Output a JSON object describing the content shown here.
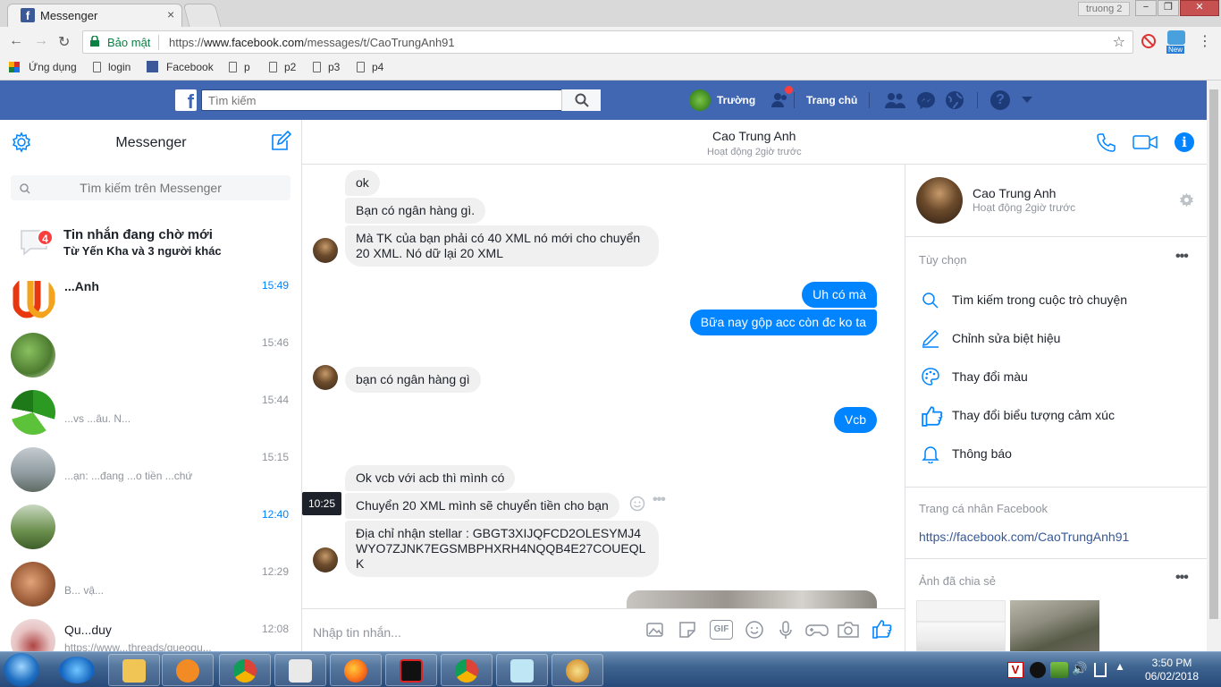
{
  "browser": {
    "tab_title": "Messenger",
    "tab_close": "×",
    "window_user": "truong 2",
    "win_min": "−",
    "win_max": "❐",
    "win_close": "✕",
    "secure_label": "Bảo mật",
    "url_prefix": "https://",
    "url_domain": "www.facebook.com",
    "url_path": "/messages/t/CaoTrungAnh91",
    "bookmarks": [
      "Ứng dụng",
      "login",
      "Facebook",
      "p",
      "p2",
      "p3",
      "p4"
    ],
    "ext_badge": "New"
  },
  "fb": {
    "logo": "f",
    "search_placeholder": "Tìm kiếm",
    "profile_name": "Trường",
    "home_label": "Trang chủ"
  },
  "messenger": {
    "title": "Messenger",
    "search_placeholder": "Tìm kiếm trên Messenger",
    "pending_count": "4",
    "pending_title": "Tin nhắn đang chờ mới",
    "pending_sub": "Từ Yến Kha và 3 người khác",
    "conversations": [
      {
        "name": "...Anh",
        "snippet": "",
        "time": "15:49",
        "unread": true
      },
      {
        "name": "",
        "snippet": "",
        "time": "15:46",
        "unread": false
      },
      {
        "name": "",
        "snippet": "...vs ...âu. N...",
        "time": "15:44",
        "unread": false
      },
      {
        "name": "",
        "snippet": "...ạn: ...đang ...o tiền ...chứ",
        "time": "15:15",
        "unread": false
      },
      {
        "name": "",
        "snippet": "",
        "time": "12:40",
        "unread": true
      },
      {
        "name": "",
        "snippet": "B...  vậ...",
        "time": "12:29",
        "unread": false
      },
      {
        "name": "Qu...duy",
        "snippet": "https://www...threads/gueogu...",
        "time": "12:08",
        "unread": false
      }
    ]
  },
  "chat": {
    "name": "Cao Trung Anh",
    "status": "Hoạt động 2giờ trước",
    "messages": [
      {
        "from": "them",
        "text": "ok"
      },
      {
        "from": "them",
        "text": "Bạn có ngân hàng gì."
      },
      {
        "from": "them",
        "text": "Mà TK của bạn phải có 40 XML nó mới cho chuyển 20 XML. Nó dữ lại 20 XML"
      },
      {
        "from": "me",
        "text": "Uh có mà"
      },
      {
        "from": "me",
        "text": "Bữa nay gộp acc còn đc ko ta"
      },
      {
        "from": "them",
        "text": "bạn có ngân hàng gì"
      },
      {
        "from": "me",
        "text": "Vcb"
      },
      {
        "from": "them",
        "text": "Ok vcb với acb thì mình có"
      },
      {
        "from": "them",
        "text": "Chuyển 20 XML mình sẽ chuyển tiền cho bạn"
      },
      {
        "from": "them",
        "text": "Địa chỉ nhận stellar : GBGT3XIJQFCD2OLESYMJ4WYO7ZJNK7EGSMBPHXRH4NQQB4E27COUEQLK"
      }
    ],
    "hover_time": "10:25",
    "composer_placeholder": "Nhập tin nhắn...",
    "gif_label": "GIF"
  },
  "info": {
    "name": "Cao Trung Anh",
    "status": "Hoạt động 2giờ trước",
    "options_label": "Tùy chọn",
    "options": [
      {
        "icon": "search-icon",
        "label": "Tìm kiếm trong cuộc trò chuyện"
      },
      {
        "icon": "pencil-icon",
        "label": "Chỉnh sửa biệt hiệu"
      },
      {
        "icon": "palette-icon",
        "label": "Thay đổi màu"
      },
      {
        "icon": "thumbs-up-icon",
        "label": "Thay đổi biểu tượng cảm xúc"
      },
      {
        "icon": "bell-icon",
        "label": "Thông báo"
      }
    ],
    "profile_label": "Trang cá nhân Facebook",
    "profile_link": "https://facebook.com/CaoTrungAnh91",
    "shared_label": "Ảnh đã chia sẻ"
  },
  "taskbar": {
    "time": "3:50 PM",
    "date": "06/02/2018"
  },
  "colors": {
    "fb_blue": "#4267b2",
    "messenger_blue": "#0084ff",
    "bubble_gray": "#f1f0f0"
  }
}
